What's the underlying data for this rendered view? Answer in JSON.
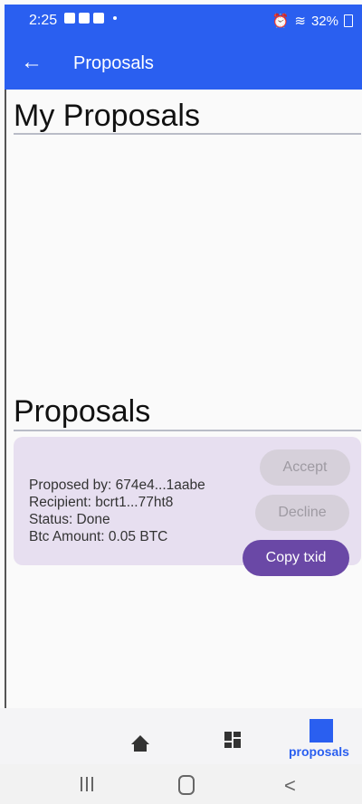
{
  "status_bar": {
    "time": "2:25",
    "battery": "32%"
  },
  "app_bar": {
    "title": "Proposals",
    "back_icon": "←"
  },
  "my_proposals": {
    "heading": "My Proposals"
  },
  "proposals": {
    "heading": "Proposals",
    "items": [
      {
        "proposed_by": "Proposed by: 674e4...1aabe",
        "recipient": "Recipient: bcrt1...77ht8",
        "status": "Status: Done",
        "btc_amount": "Btc Amount: 0.05 BTC",
        "accept_label": "Accept",
        "decline_label": "Decline",
        "copy_label": "Copy txid"
      }
    ]
  },
  "bottom_nav": {
    "active_label": "proposals"
  },
  "system_nav": {
    "back_glyph": "<"
  },
  "colors": {
    "primary": "#2a5ff0",
    "button_purple": "#6a48a6",
    "card_bg": "#e7dff0"
  }
}
